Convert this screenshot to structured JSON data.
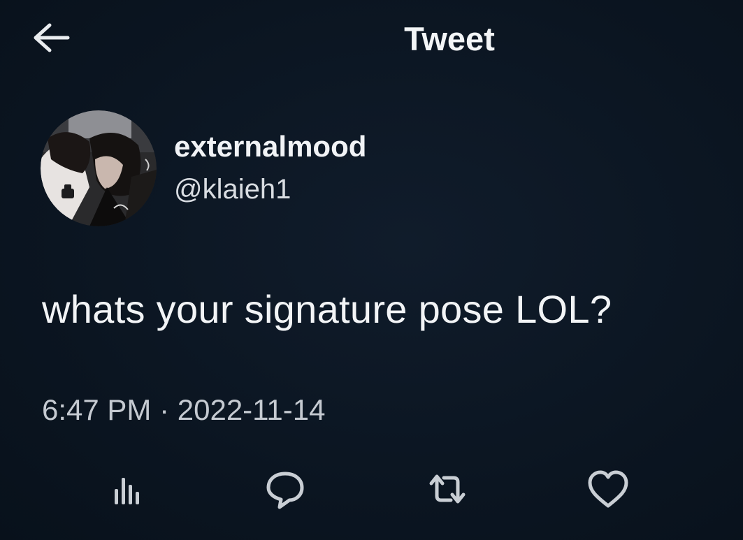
{
  "header": {
    "back_icon": "arrow-left-icon",
    "title": "Tweet"
  },
  "author": {
    "display_name": "externalmood",
    "handle": "@klaieh1",
    "avatar": "profile-photo"
  },
  "tweet": {
    "text": "whats your signature pose LOL?",
    "time": "6:47 PM",
    "separator": "·",
    "date": "2022-11-14",
    "timestamp": "6:47 PM · 2022-11-14"
  },
  "actions": [
    {
      "name": "analytics",
      "icon": "bar-chart-icon"
    },
    {
      "name": "reply",
      "icon": "speech-bubble-icon"
    },
    {
      "name": "retweet",
      "icon": "retweet-icon"
    },
    {
      "name": "like",
      "icon": "heart-icon"
    }
  ],
  "colors": {
    "background": "#0c1623",
    "text_primary": "#f2f4f6",
    "text_secondary": "#c5cad1"
  }
}
